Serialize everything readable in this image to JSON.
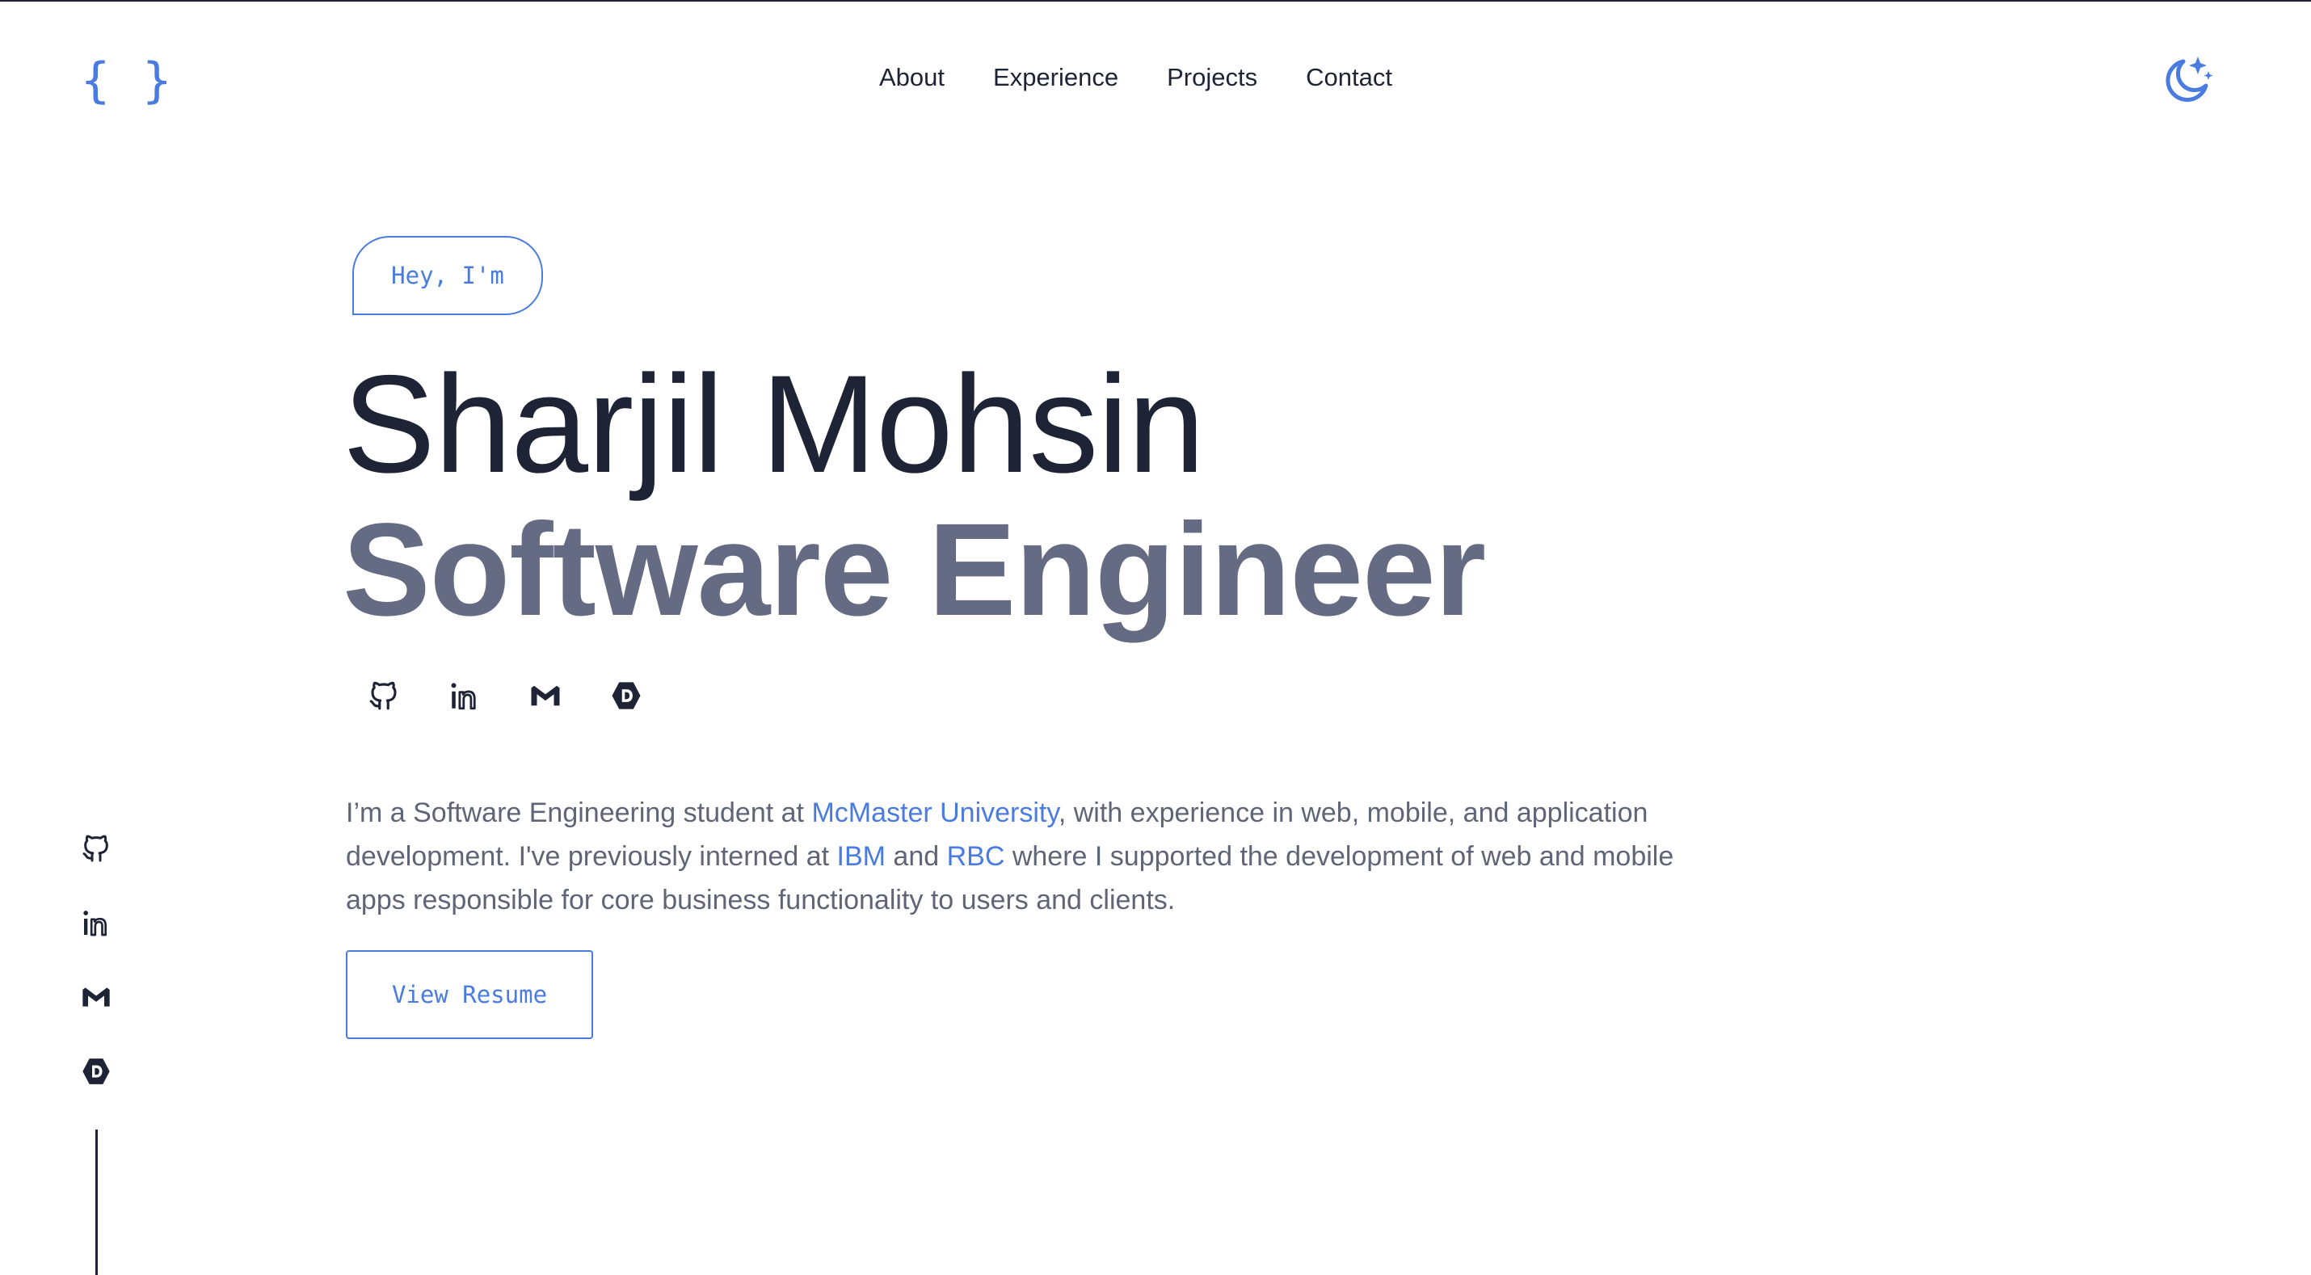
{
  "header": {
    "logo": "{ }",
    "nav": [
      {
        "label": "About"
      },
      {
        "label": "Experience"
      },
      {
        "label": "Projects"
      },
      {
        "label": "Contact"
      }
    ],
    "theme_toggle_icon": "moon-stars-icon"
  },
  "hero": {
    "greeting": "Hey, I'm",
    "name": "Sharjil Mohsin",
    "role": "Software Engineer",
    "social_icons": [
      "github-icon",
      "linkedin-icon",
      "gmail-icon",
      "devpost-icon"
    ],
    "bio": {
      "part1": "I’m a Software Engineering student at ",
      "link1": "McMaster University",
      "part2": ", with experience in web, mobile, and application development. I've previously interned at ",
      "link2": "IBM",
      "part3": " and ",
      "link3": "RBC",
      "part4": " where I supported the development of web and mobile apps responsible for core business functionality to users and clients."
    },
    "resume_button": "View Resume"
  },
  "sidebar": {
    "social_icons": [
      "github-icon",
      "linkedin-icon",
      "gmail-icon",
      "devpost-icon"
    ]
  },
  "colors": {
    "accent": "#4a7be0",
    "heading": "#1e2435",
    "subheading": "#646b82",
    "body_text": "#5f6577"
  }
}
